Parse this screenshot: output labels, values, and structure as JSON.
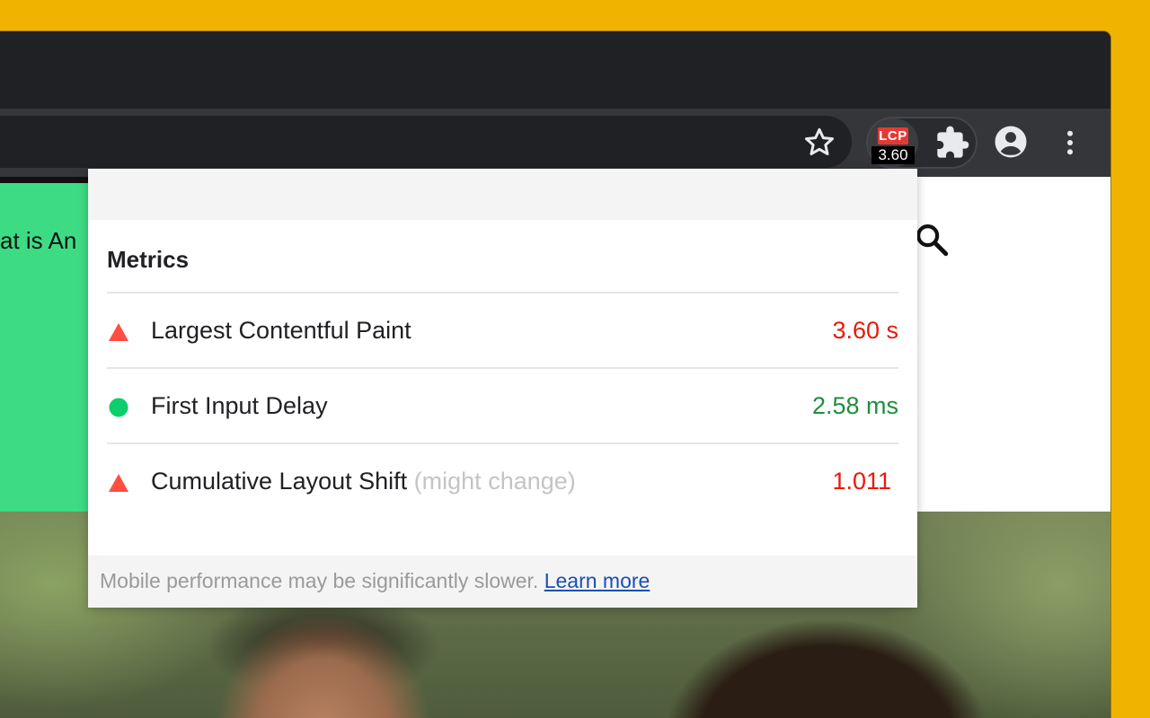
{
  "colors": {
    "background": "#f0b400",
    "chrome_dark": "#202124",
    "toolbar": "#35363a",
    "poor": "#e8190c",
    "good": "#1e8e3e",
    "good_dot": "#0cce6b",
    "poor_triangle": "#ff4e42",
    "link": "#1a4fb3"
  },
  "toolbar": {
    "bookmark_icon": "star-outline-icon",
    "extension_badge": {
      "tag": "LCP",
      "value": "3.60"
    },
    "extensions_icon": "puzzle-icon",
    "profile_icon": "account-circle-icon",
    "menu_icon": "kebab-menu-icon"
  },
  "page": {
    "heading_fragment": "at is An",
    "search_icon": "search-icon"
  },
  "popup": {
    "title": "Metrics",
    "metrics": [
      {
        "label": "Largest Contentful Paint",
        "note": "",
        "value": "3.60 s",
        "status": "poor",
        "indicator": "triangle-icon"
      },
      {
        "label": "First Input Delay",
        "note": "",
        "value": "2.58 ms",
        "status": "good",
        "indicator": "circle-icon"
      },
      {
        "label": "Cumulative Layout Shift",
        "note": "(might change)",
        "value": "1.011",
        "status": "poor",
        "indicator": "triangle-icon"
      }
    ],
    "footer": {
      "text": "Mobile performance may be significantly slower.",
      "link": "Learn more"
    }
  }
}
